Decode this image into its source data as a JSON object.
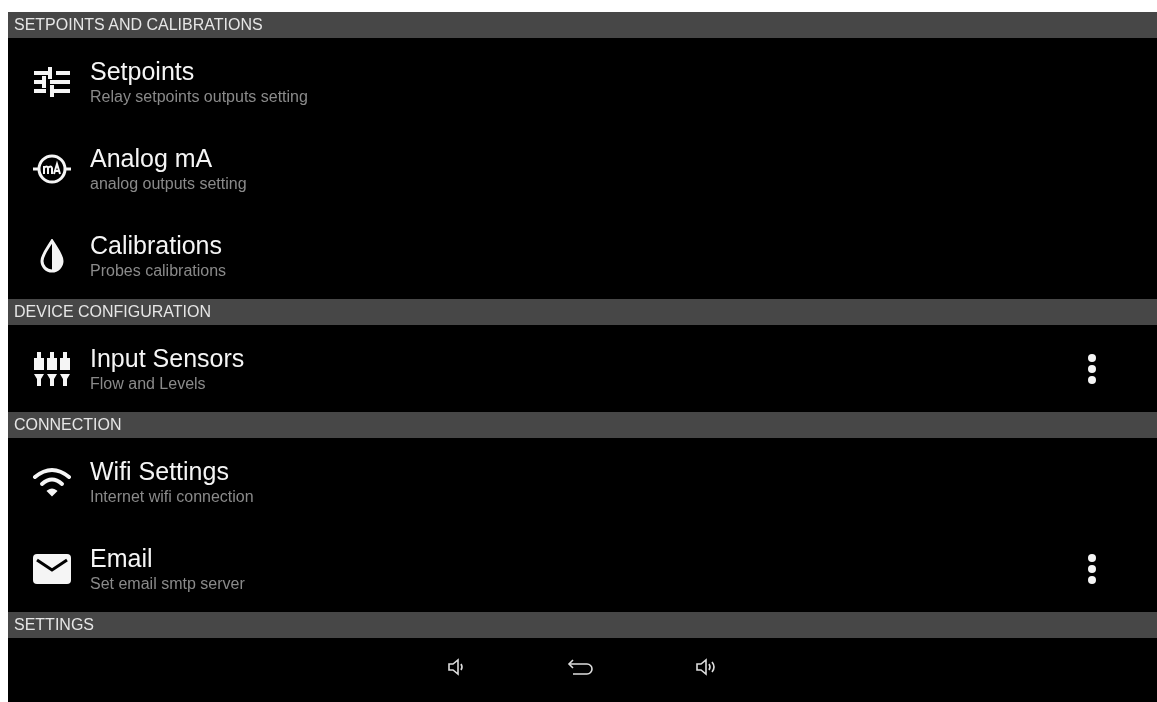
{
  "sections": [
    {
      "title": "SETPOINTS AND CALIBRATIONS",
      "items": [
        {
          "title": "Setpoints",
          "subtitle": "Relay setpoints outputs setting",
          "menu": false
        },
        {
          "title": "Analog mA",
          "subtitle": "analog outputs setting",
          "menu": false
        },
        {
          "title": "Calibrations",
          "subtitle": "Probes calibrations",
          "menu": false
        }
      ]
    },
    {
      "title": "DEVICE CONFIGURATION",
      "items": [
        {
          "title": "Input Sensors",
          "subtitle": "Flow and Levels",
          "menu": true
        }
      ]
    },
    {
      "title": "CONNECTION",
      "items": [
        {
          "title": "Wifi Settings",
          "subtitle": "Internet wifi connection",
          "menu": false
        },
        {
          "title": "Email",
          "subtitle": "Set email smtp server",
          "menu": true
        }
      ]
    },
    {
      "title": "SETTINGS"
    }
  ]
}
